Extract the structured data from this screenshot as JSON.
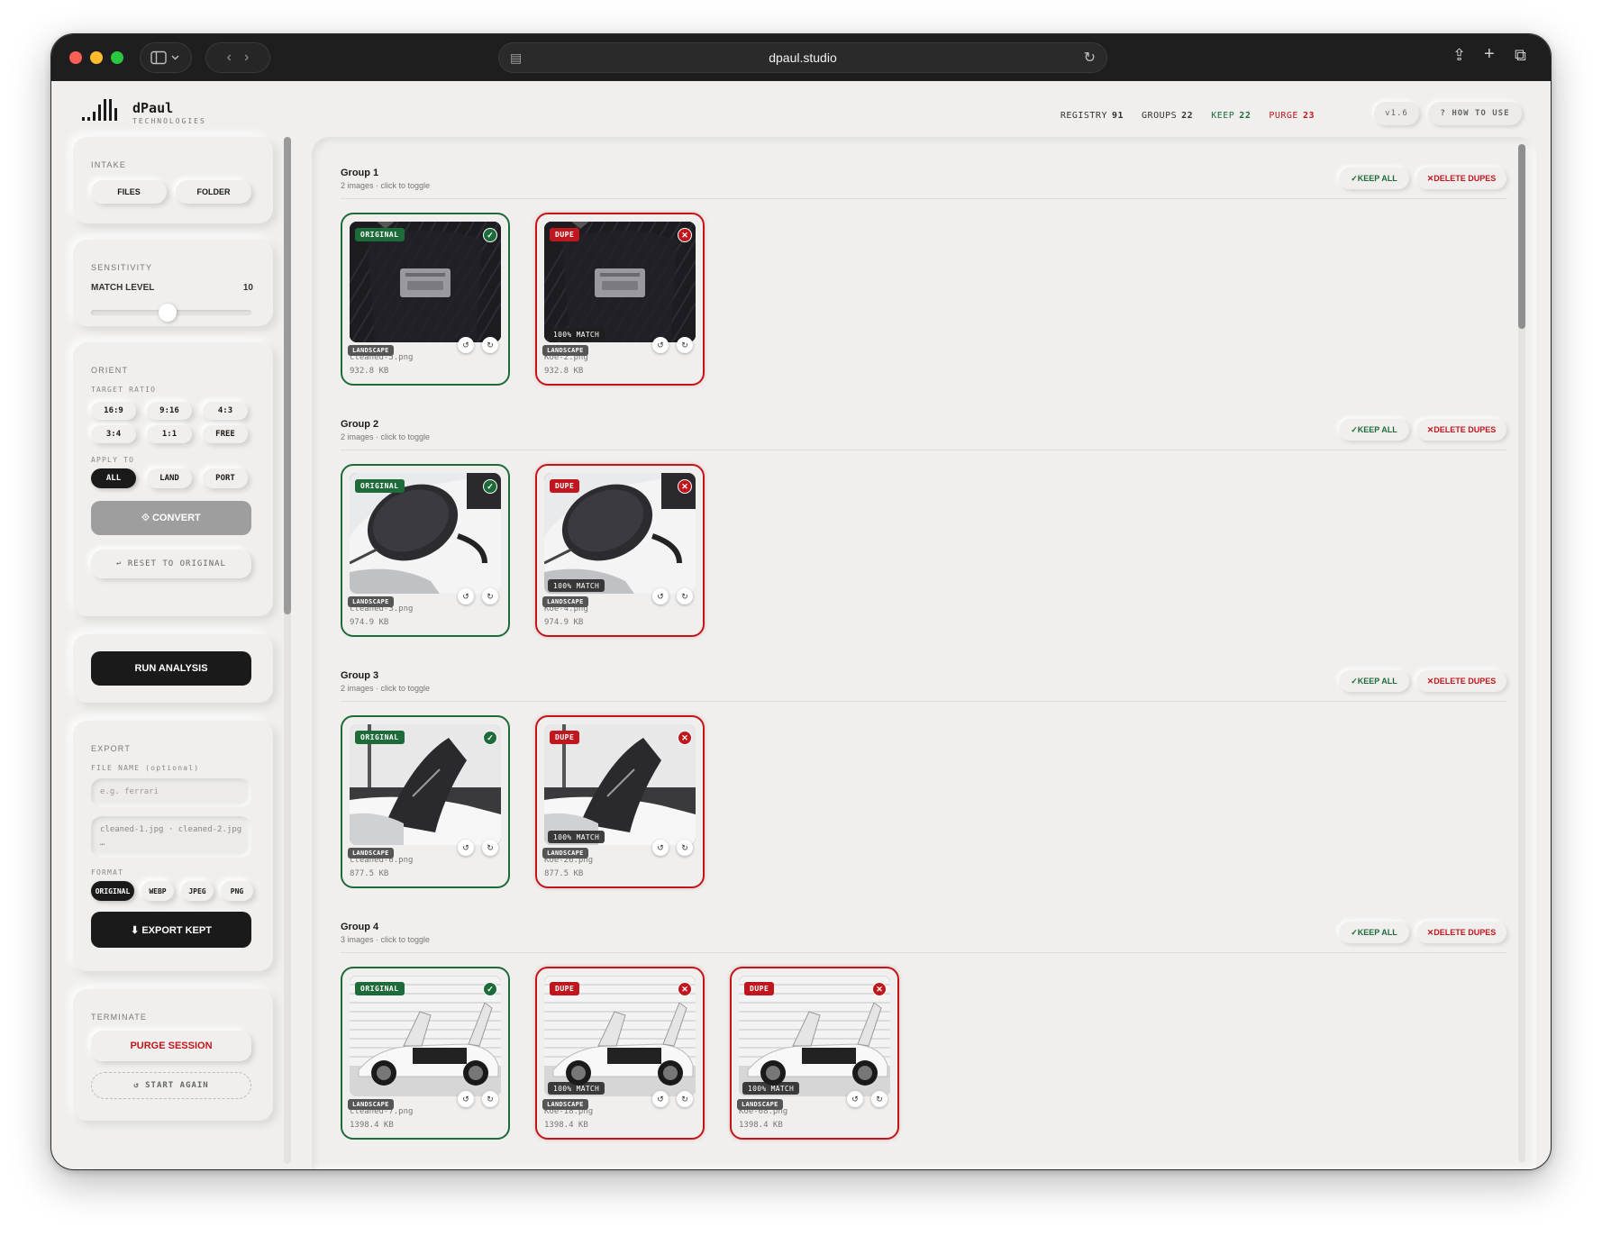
{
  "browser": {
    "url": "dpaul.studio"
  },
  "brand": {
    "name": "dPaul",
    "sub": "TECHNOLOGIES"
  },
  "stats": [
    {
      "label": "REGISTRY",
      "value": "91",
      "color": "#1a1a1a"
    },
    {
      "label": "GROUPS",
      "value": "22",
      "color": "#1a1a1a"
    },
    {
      "label": "KEEP",
      "value": "22",
      "color": "#1e6b3a"
    },
    {
      "label": "PURGE",
      "value": "23",
      "color": "#c0161d"
    }
  ],
  "version": "v1.6",
  "how_to_use": "? HOW TO USE",
  "intake": {
    "title": "INTAKE",
    "files": "FILES",
    "folder": "FOLDER"
  },
  "sensitivity": {
    "title": "SENSITIVITY",
    "label": "MATCH LEVEL",
    "value": "10",
    "slider_fraction": 0.48
  },
  "orient": {
    "title": "ORIENT",
    "target_ratio_label": "TARGET RATIO",
    "ratios": [
      "16:9",
      "9:16",
      "4:3",
      "3:4",
      "1:1",
      "FREE"
    ],
    "apply_to_label": "APPLY TO",
    "apply_options": [
      "ALL",
      "LAND",
      "PORT"
    ],
    "apply_selected": "ALL",
    "convert": "⟐ CONVERT",
    "reset": "↩ RESET TO ORIGINAL"
  },
  "run_analysis": "RUN ANALYSIS",
  "export": {
    "title": "EXPORT",
    "file_name_label": "FILE NAME (optional)",
    "placeholder": "e.g. ferrari",
    "preview": "cleaned-1.jpg · cleaned-2.jpg …",
    "format_label": "FORMAT",
    "formats": [
      "ORIGINAL",
      "WEBP",
      "JPEG",
      "PNG"
    ],
    "format_selected": "ORIGINAL",
    "export_btn": "⬇ EXPORT KEPT"
  },
  "terminate": {
    "title": "TERMINATE",
    "purge": "PURGE SESSION",
    "start_again": "↺ START AGAIN"
  },
  "labels": {
    "keep_all": "✓KEEP ALL",
    "delete_dupes": "✕DELETE DUPES",
    "original": "ORIGINAL",
    "dupe": "DUPE",
    "match": "100% MATCH",
    "landscape": "LANDSCAPE"
  },
  "groups": [
    {
      "title": "Group 1",
      "sub": "2 images · click to toggle",
      "thumb": "interior",
      "images": [
        {
          "status": "original",
          "file": "cleaned-5.png",
          "size": "932.8 KB"
        },
        {
          "status": "dupe",
          "file": "Koe-2.png",
          "size": "932.8 KB"
        }
      ]
    },
    {
      "title": "Group 2",
      "sub": "2 images · click to toggle",
      "thumb": "mirror",
      "images": [
        {
          "status": "original",
          "file": "cleaned-3.png",
          "size": "974.9 KB"
        },
        {
          "status": "dupe",
          "file": "Koe-4.png",
          "size": "974.9 KB"
        }
      ]
    },
    {
      "title": "Group 3",
      "sub": "2 images · click to toggle",
      "thumb": "wing",
      "images": [
        {
          "status": "original",
          "file": "cleaned-6.png",
          "size": "877.5 KB"
        },
        {
          "status": "dupe",
          "file": "Koe-26.png",
          "size": "877.5 KB"
        }
      ]
    },
    {
      "title": "Group 4",
      "sub": "3 images · click to toggle",
      "thumb": "car",
      "images": [
        {
          "status": "original",
          "file": "cleaned-7.png",
          "size": "1398.4 KB"
        },
        {
          "status": "dupe",
          "file": "Koe-18.png",
          "size": "1398.4 KB"
        },
        {
          "status": "dupe",
          "file": "Koe-68.png",
          "size": "1398.4 KB"
        }
      ]
    }
  ],
  "colors": {
    "keep": "#1e6b3a",
    "dupe": "#c0161d",
    "dark": "#1a1a1a"
  }
}
